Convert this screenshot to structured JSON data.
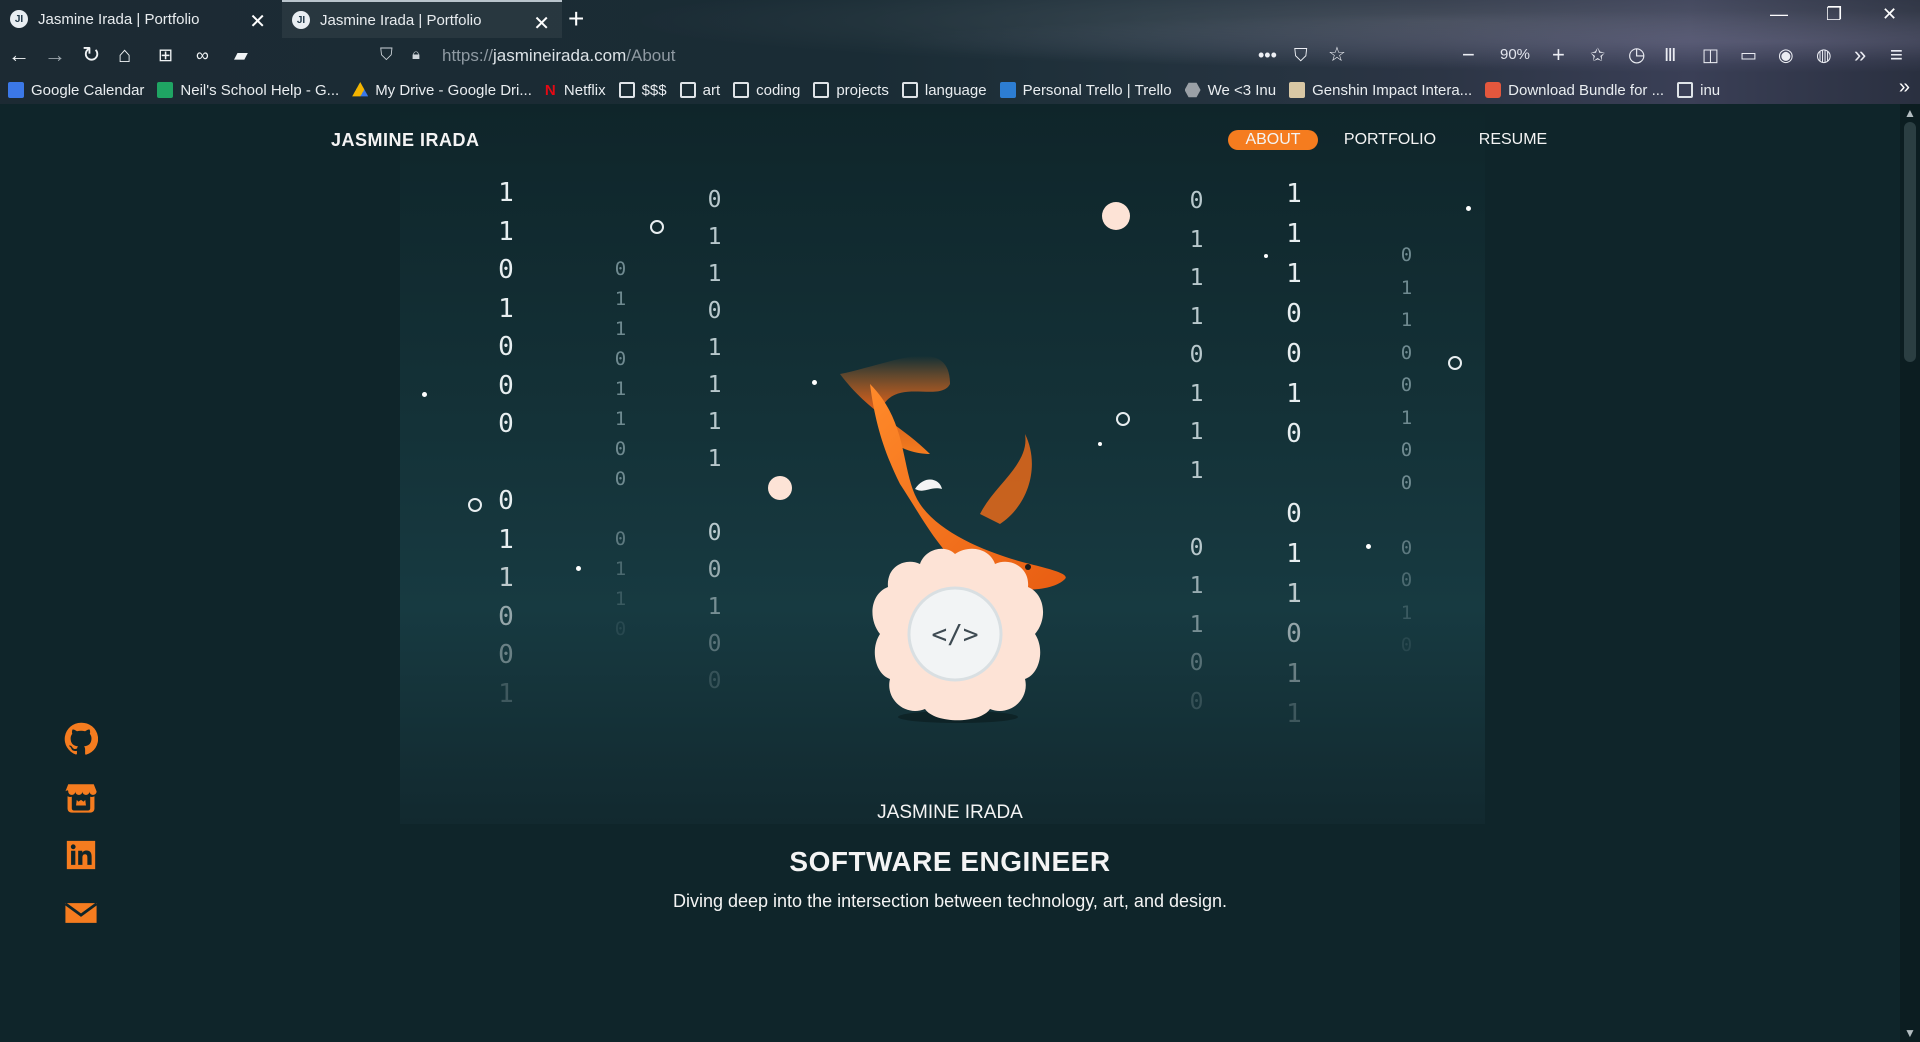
{
  "browser": {
    "tabs": [
      {
        "title": "Jasmine Irada | Portfolio",
        "active": false
      },
      {
        "title": "Jasmine Irada | Portfolio",
        "active": true
      }
    ],
    "url_prefix": "https://",
    "url_domain": "jasmineirada.com",
    "url_path": "/About",
    "zoom": "90%",
    "bookmarks": [
      {
        "label": "Google Calendar",
        "icon": "calendar-icon",
        "color": "#3b78e7"
      },
      {
        "label": "Neil's School Help - G...",
        "icon": "sheets-icon",
        "color": "#1fa463"
      },
      {
        "label": "My Drive - Google Dri...",
        "icon": "drive-icon",
        "color": "#f4b400"
      },
      {
        "label": "Netflix",
        "icon": "netflix-icon",
        "color": "#e50914"
      },
      {
        "label": "$$$",
        "icon": "folder-icon"
      },
      {
        "label": "art",
        "icon": "folder-icon"
      },
      {
        "label": "coding",
        "icon": "folder-icon"
      },
      {
        "label": "projects",
        "icon": "folder-icon"
      },
      {
        "label": "language",
        "icon": "folder-icon"
      },
      {
        "label": "Personal Trello | Trello",
        "icon": "trello-icon",
        "color": "#2d7dd2"
      },
      {
        "label": "We <3 Inu",
        "icon": "hexagon-icon",
        "color": "#9aa0a6"
      },
      {
        "label": "Genshin Impact Intera...",
        "icon": "genshin-icon",
        "color": "#d8c7a4"
      },
      {
        "label": "Download Bundle for ...",
        "icon": "bundle-icon",
        "color": "#e4573d"
      },
      {
        "label": "inu",
        "icon": "folder-icon"
      }
    ]
  },
  "site": {
    "brand": "JASMINE IRADA",
    "nav": [
      {
        "label": "ABOUT",
        "active": true
      },
      {
        "label": "PORTFOLIO",
        "active": false
      },
      {
        "label": "RESUME",
        "active": false
      }
    ],
    "hero": {
      "name": "JASMINE IRADA",
      "title": "SOFTWARE ENGINEER",
      "tagline": "Diving deep into the intersection between technology, art, and design.",
      "shell_code": "</>"
    },
    "binary_columns": [
      [
        "1",
        "1",
        "0",
        "1",
        "0",
        "0",
        "0",
        "",
        "0",
        "1",
        "1",
        "0",
        "0",
        "1"
      ],
      [
        "0",
        "1",
        "1",
        "0",
        "1",
        "1",
        "0",
        "0",
        "",
        "0",
        "1",
        "1",
        "0"
      ],
      [
        "0",
        "1",
        "1",
        "0",
        "1",
        "1",
        "1",
        "1",
        "",
        "0",
        "0",
        "1",
        "0",
        "0"
      ],
      [
        "0",
        "1",
        "1",
        "1",
        "0",
        "1",
        "1",
        "1",
        "",
        "0",
        "1",
        "1",
        "0",
        "0"
      ],
      [
        "1",
        "1",
        "1",
        "0",
        "0",
        "1",
        "0",
        "",
        "0",
        "1",
        "1",
        "0",
        "1",
        "1"
      ],
      [
        "0",
        "1",
        "1",
        "0",
        "0",
        "1",
        "0",
        "0",
        "",
        "0",
        "0",
        "1",
        "0"
      ]
    ],
    "social": [
      {
        "name": "github-icon"
      },
      {
        "name": "itch-io-icon"
      },
      {
        "name": "linkedin-icon"
      },
      {
        "name": "email-icon"
      }
    ],
    "colors": {
      "accent": "#f57c1f",
      "background": "#0f252a",
      "pearl": "#fde3d6"
    }
  }
}
